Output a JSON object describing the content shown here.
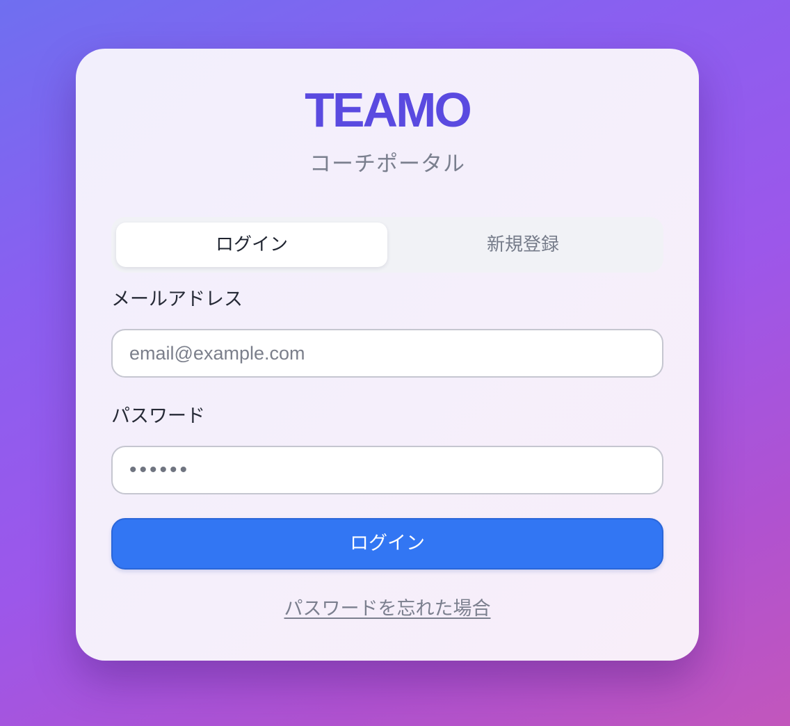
{
  "brand": {
    "logo_text": "TEAMO",
    "subtitle": "コーチポータル"
  },
  "tabs": [
    {
      "label": "ログイン",
      "active": true
    },
    {
      "label": "新規登録",
      "active": false
    }
  ],
  "form": {
    "email": {
      "label": "メールアドレス",
      "placeholder": "email@example.com",
      "value": ""
    },
    "password": {
      "label": "パスワード",
      "value": "••••••"
    },
    "submit_label": "ログイン"
  },
  "forgot_link": "パスワードを忘れた場合",
  "colors": {
    "brand": "#5a4ae0",
    "primary_button": "#3276f3",
    "background_start": "#6f6ff0",
    "background_end": "#c256bc"
  }
}
